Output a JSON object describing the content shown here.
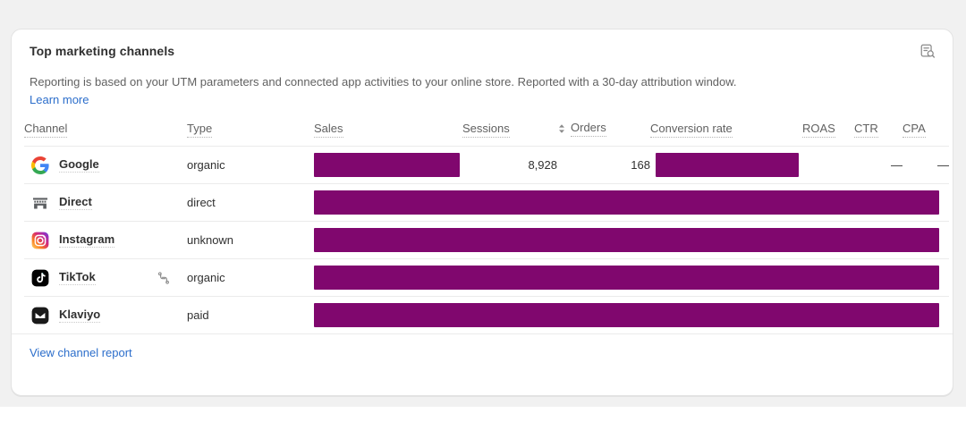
{
  "card": {
    "title": "Top marketing channels",
    "description": "Reporting is based on your UTM parameters and connected app activities to your online store. Reported with a 30-day attribution window.",
    "learn_more_label": "Learn more",
    "report_icon": "report-search-icon",
    "footer_link_label": "View channel report"
  },
  "table": {
    "columns": [
      {
        "label": "Channel",
        "align": "left",
        "sortable": false,
        "tooltip": true
      },
      {
        "label": "Type",
        "align": "left",
        "sortable": false,
        "tooltip": true
      },
      {
        "label": "Sales",
        "align": "right",
        "sortable": false,
        "tooltip": true
      },
      {
        "label": "Sessions",
        "align": "right",
        "sortable": false,
        "tooltip": true
      },
      {
        "label": "Orders",
        "align": "right",
        "sortable": true,
        "tooltip": true,
        "sort_icon": "sort-chevrons-icon"
      },
      {
        "label": "Conversion rate",
        "align": "right",
        "sortable": false,
        "tooltip": true
      },
      {
        "label": "ROAS",
        "align": "right",
        "sortable": false,
        "tooltip": true
      },
      {
        "label": "CTR",
        "align": "right",
        "sortable": false,
        "tooltip": true
      },
      {
        "label": "CPA",
        "align": "right",
        "sortable": false,
        "tooltip": true
      }
    ],
    "rows": [
      {
        "channel": "Google",
        "icon": "google-icon",
        "type": "organic",
        "type_flag_icon": null,
        "sales": "",
        "sales_redacted": true,
        "sessions": "8,928",
        "orders": "168",
        "conversion_rate": "",
        "conversion_redacted": true,
        "roas": "",
        "roas_redacted": false,
        "ctr": "—",
        "cpa": "—",
        "full_row_redacted": false
      },
      {
        "channel": "Direct",
        "icon": "storefront-icon",
        "type": "direct",
        "type_flag_icon": null,
        "full_row_redacted": true
      },
      {
        "channel": "Instagram",
        "icon": "instagram-icon",
        "type": "unknown",
        "type_flag_icon": null,
        "full_row_redacted": true
      },
      {
        "channel": "TikTok",
        "icon": "tiktok-icon",
        "type": "organic",
        "type_flag_icon": "branch-flow-icon",
        "full_row_redacted": true
      },
      {
        "channel": "Klaviyo",
        "icon": "klaviyo-icon",
        "type": "paid",
        "type_flag_icon": null,
        "full_row_redacted": true
      }
    ]
  },
  "colors": {
    "redaction_bar": "#80076e",
    "link": "#2c6ecb",
    "text_primary": "#303030",
    "text_secondary": "#616161",
    "card_border": "#e3e3e3",
    "page_background": "#f1f1f1"
  }
}
